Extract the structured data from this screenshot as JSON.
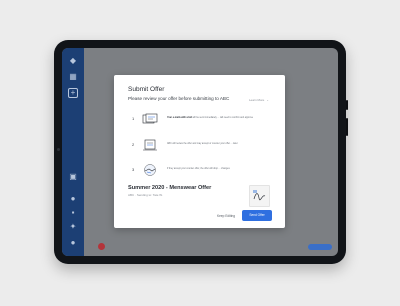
{
  "modal": {
    "title": "Submit Offer",
    "subtitle": "Please review your offer before submitting to ABC",
    "dropdown_label": "Learn More",
    "steps": [
      {
        "num": "1",
        "bold": "Your e-mails with a bid",
        "rest": " will be sent immediately ... will need to confirm and approve"
      },
      {
        "num": "2",
        "bold": "",
        "rest": "ABC will review the offer and may accept or counter your offer ... later"
      },
      {
        "num": "3",
        "bold": "",
        "rest": "If they accept your counter offer, the offer will drop ... changes"
      }
    ],
    "offer_title": "Summer 2020 - Menswear Offer",
    "offer_meta": "ABC · Sending to: Tate W.",
    "keep_editing": "Keep Editing",
    "send_offer": "Send Offer"
  },
  "icons": {
    "sidebar": [
      "logo-icon",
      "grid-icon",
      "plus-icon",
      "user-icon",
      "bell-icon",
      "chat-icon",
      "settings-icon",
      "profile-icon"
    ]
  },
  "colors": {
    "sidebar": "#1c3f74",
    "accent": "#2f6fe0",
    "overlay": "#7c7f83"
  }
}
